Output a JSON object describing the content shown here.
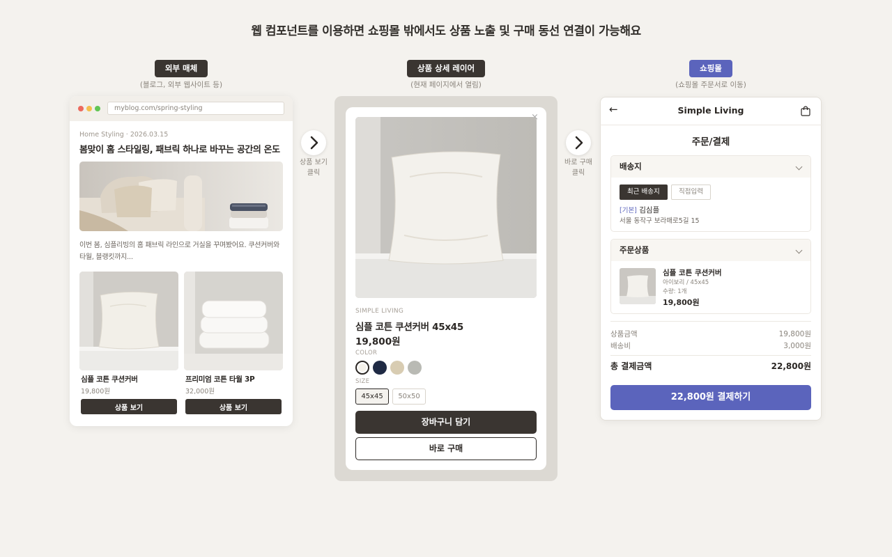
{
  "headline": "웹 컴포넌트를 이용하면 쇼핑몰 밖에서도 상품 노출 및 구매 동선 연결이 가능해요",
  "columns": [
    {
      "badge": "외부 매체",
      "caption": "(블로그, 외부 웹사이트 등)"
    },
    {
      "badge": "상품 상세 레이어",
      "caption": "(현재 페이지에서 열림)"
    },
    {
      "badge": "쇼핑몰",
      "caption": "(쇼핑몰 주문서로 이동)"
    }
  ],
  "colors": {
    "accent": "#5b64bc",
    "dark": "#3a3531",
    "background": "#f4f2ee"
  },
  "blog": {
    "url": "myblog.com/spring-styling",
    "meta": "Home Styling · 2026.03.15",
    "title": "봄맞이 홈 스타일링, 패브릭 하나로 바꾸는 공간의 온도",
    "intro": "이번 봄, 심플리빙의 홈 패브릭 라인으로 거실을 꾸며봤어요. 쿠션커버와 타월, 블랭킷까지...",
    "products": [
      {
        "name": "심플 코튼 쿠션커버",
        "price": "19,800원",
        "button": "상품 보기"
      },
      {
        "name": "프리미엄 코튼 타월 3P",
        "price": "32,000원",
        "button": "상품 보기"
      }
    ]
  },
  "arrows": [
    {
      "label_1": "상품 보기",
      "label_2": "클릭",
      "icon": "chevron-right-icon"
    },
    {
      "label_1": "바로 구매",
      "label_2": "클릭",
      "icon": "chevron-right-icon"
    }
  ],
  "layer": {
    "close": "×",
    "brand": "SIMPLE LIVING",
    "name": "심플 코튼 쿠션커버 45x45",
    "price": "19,800원",
    "color_label": "COLOR",
    "colors": [
      "#f4f1ea",
      "#1f2a44",
      "#d8ccb2",
      "#b9bab4"
    ],
    "selected_color_index": 0,
    "size_label": "SIZE",
    "sizes": [
      "45x45",
      "50x50"
    ],
    "selected_size": "45x45",
    "cart_button": "장바구니 담기",
    "buy_button": "바로 구매"
  },
  "checkout": {
    "back_icon": "←",
    "shop_name": "Simple Living",
    "page_title": "주문/결제",
    "shipping": {
      "title": "배송지",
      "tabs": [
        "최근 배송지",
        "직접입력"
      ],
      "tag": "[기본]",
      "name": "김심플",
      "address": "서울 동작구 보라매로5길 15"
    },
    "items": {
      "title": "주문상품",
      "name": "심플 코튼 쿠션커버",
      "option": "아이보리 / 45x45",
      "qty": "수량: 1개",
      "price": "19,800원"
    },
    "summary": {
      "subtotal_label": "상품금액",
      "subtotal": "19,800원",
      "shipping_label": "배송비",
      "shipping": "3,000원",
      "total_label": "총 결제금액",
      "total": "22,800원"
    },
    "pay_button": "22,800원 결제하기"
  }
}
